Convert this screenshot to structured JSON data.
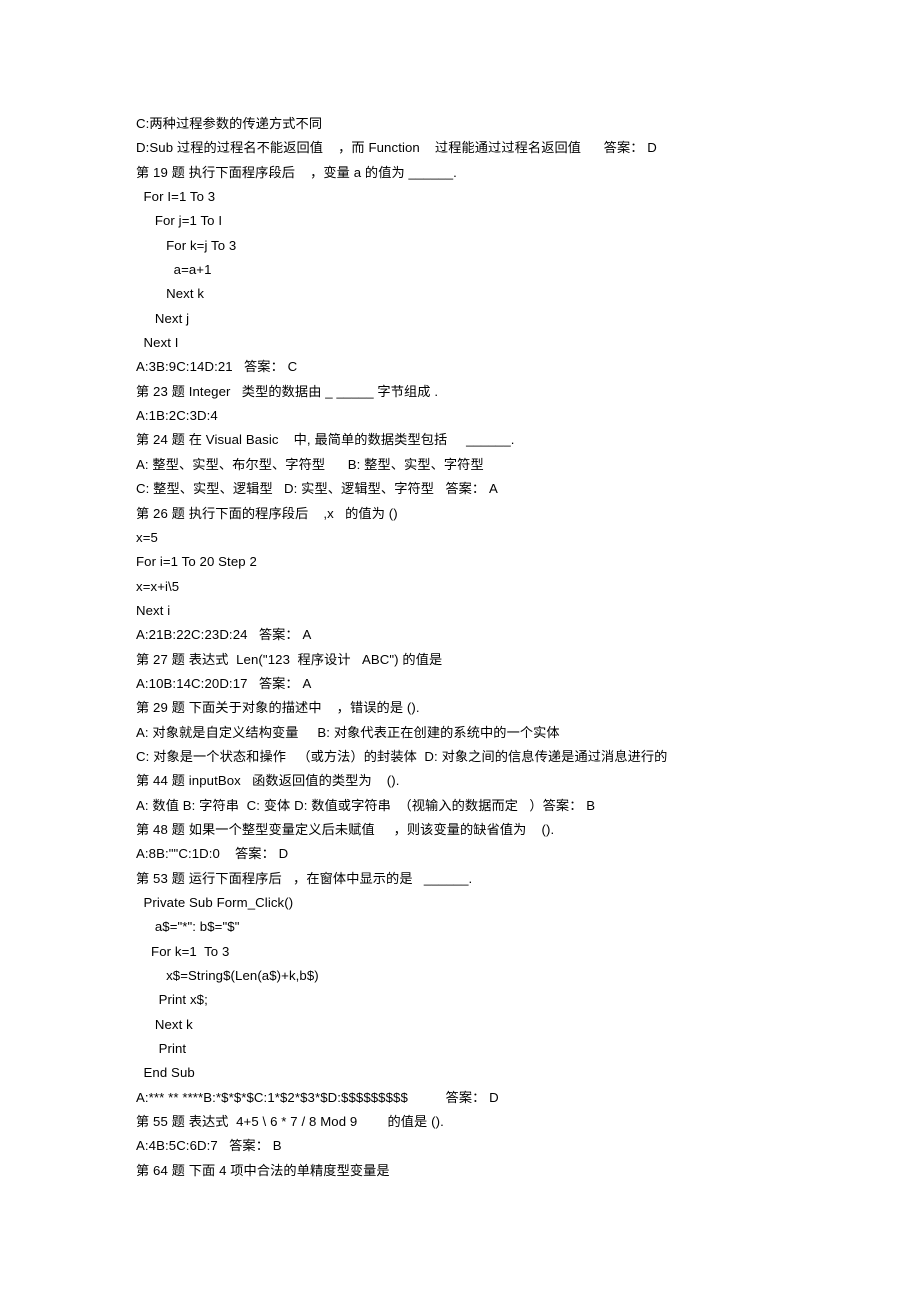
{
  "document": {
    "type": "exam-question-bank",
    "subject": "Visual Basic",
    "lines": [
      {
        "id": "l1",
        "kind": "option",
        "text": "C:两种过程参数的传递方式不同"
      },
      {
        "id": "l2",
        "kind": "option",
        "text": "D:Sub 过程的过程名不能返回值    ，而 Function    过程能通过过程名返回值      答案： D"
      },
      {
        "id": "l3",
        "kind": "question",
        "text": "第 19 题 执行下面程序段后    ，变量 a 的值为 ______."
      },
      {
        "id": "l4",
        "kind": "code",
        "text": "  For I=1 To 3"
      },
      {
        "id": "l5",
        "kind": "code",
        "text": "     For j=1 To I"
      },
      {
        "id": "l6",
        "kind": "code",
        "text": "        For k=j To 3"
      },
      {
        "id": "l7",
        "kind": "code",
        "text": "          a=a+1"
      },
      {
        "id": "l8",
        "kind": "code",
        "text": "        Next k"
      },
      {
        "id": "l9",
        "kind": "code",
        "text": "     Next j"
      },
      {
        "id": "l10",
        "kind": "code",
        "text": "  Next I"
      },
      {
        "id": "l11",
        "kind": "answer",
        "text": "A:3B:9C:14D:21   答案： C"
      },
      {
        "id": "l12",
        "kind": "question",
        "text": "第 23 题 Integer   类型的数据由 _ _____ 字节组成 ."
      },
      {
        "id": "l13",
        "kind": "option",
        "text": "A:1B:2C:3D:4"
      },
      {
        "id": "l14",
        "kind": "question",
        "text": "第 24 题 在 Visual Basic    中, 最简单的数据类型包括     ______."
      },
      {
        "id": "l15",
        "kind": "option",
        "text": "A: 整型、实型、布尔型、字符型      B: 整型、实型、字符型"
      },
      {
        "id": "l16",
        "kind": "option",
        "text": "C: 整型、实型、逻辑型   D: 实型、逻辑型、字符型   答案： A"
      },
      {
        "id": "l17",
        "kind": "question",
        "text": "第 26 题 执行下面的程序段后    ,x   的值为 ()"
      },
      {
        "id": "l18",
        "kind": "code",
        "text": "x=5"
      },
      {
        "id": "l19",
        "kind": "code",
        "text": "For i=1 To 20 Step 2"
      },
      {
        "id": "l20",
        "kind": "code",
        "text": "x=x+i\\5"
      },
      {
        "id": "l21",
        "kind": "code",
        "text": "Next i"
      },
      {
        "id": "l22",
        "kind": "answer",
        "text": "A:21B:22C:23D:24   答案： A"
      },
      {
        "id": "l23",
        "kind": "question",
        "text": "第 27 题 表达式  Len(\"123  程序设计   ABC\") 的值是"
      },
      {
        "id": "l24",
        "kind": "answer",
        "text": "A:10B:14C:20D:17   答案： A"
      },
      {
        "id": "l25",
        "kind": "question",
        "text": "第 29 题 下面关于对象的描述中    ，错误的是 ()."
      },
      {
        "id": "l26",
        "kind": "option",
        "text": "A: 对象就是自定义结构变量     B: 对象代表正在创建的系统中的一个实体"
      },
      {
        "id": "l27",
        "kind": "option",
        "text": "C: 对象是一个状态和操作   （或方法）的封装体  D: 对象之间的信息传递是通过消息进行的"
      },
      {
        "id": "l28",
        "kind": "question",
        "text": "第 44 题 inputBox   函数返回值的类型为    ()."
      },
      {
        "id": "l29",
        "kind": "option",
        "text": "A: 数值 B: 字符串  C: 变体 D: 数值或字符串  （视输入的数据而定   ）答案： B"
      },
      {
        "id": "l30",
        "kind": "question",
        "text": "第 48 题 如果一个整型变量定义后未赋值     ，则该变量的缺省值为    ()."
      },
      {
        "id": "l31",
        "kind": "answer",
        "text": "A:8B:\"\"C:1D:0    答案： D"
      },
      {
        "id": "l32",
        "kind": "question",
        "text": "第 53 题 运行下面程序后   ，在窗体中显示的是   ______."
      },
      {
        "id": "l33",
        "kind": "code",
        "text": "  Private Sub Form_Click()"
      },
      {
        "id": "l34",
        "kind": "code",
        "text": "     a$=\"*\": b$=\"$\""
      },
      {
        "id": "l35",
        "kind": "code",
        "text": "    For k=1  To 3"
      },
      {
        "id": "l36",
        "kind": "code",
        "text": "        x$=String$(Len(a$)+k,b$)"
      },
      {
        "id": "l37",
        "kind": "code",
        "text": "      Print x$;"
      },
      {
        "id": "l38",
        "kind": "code",
        "text": "     Next k"
      },
      {
        "id": "l39",
        "kind": "code",
        "text": "      Print"
      },
      {
        "id": "l40",
        "kind": "code",
        "text": "  End Sub"
      },
      {
        "id": "l41",
        "kind": "answer",
        "text": "A:*** ** ****B:*$*$*$C:1*$2*$3*$D:$$$$$$$$$          答案： D"
      },
      {
        "id": "l42",
        "kind": "question",
        "text": "第 55 题 表达式  4+5 \\ 6 * 7 / 8 Mod 9        的值是 ()."
      },
      {
        "id": "l43",
        "kind": "answer",
        "text": "A:4B:5C:6D:7   答案： B"
      },
      {
        "id": "l44",
        "kind": "question",
        "text": "第 64 题 下面 4 项中合法的单精度型变量是"
      }
    ]
  }
}
